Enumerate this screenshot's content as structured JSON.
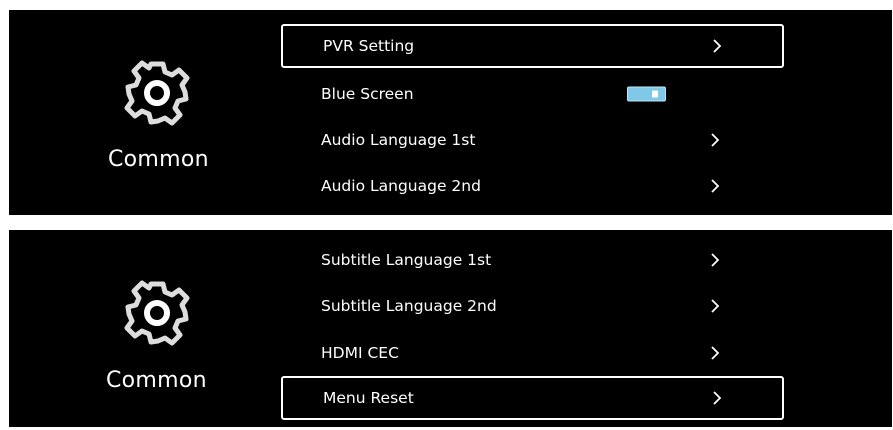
{
  "colors": {
    "background": "#000000",
    "text": "#ffffff",
    "focus_border": "#ffffff",
    "toggle_on": "#7fc8e8"
  },
  "panels": [
    {
      "category": {
        "icon": "gear-icon",
        "label": "Common"
      },
      "items": [
        {
          "label": "PVR Setting",
          "control": "chevron-right-icon",
          "focused": true
        },
        {
          "label": "Blue Screen",
          "control": "toggle",
          "state": "on",
          "focused": false
        },
        {
          "label": "Audio Language 1st",
          "control": "chevron-right-icon",
          "focused": false
        },
        {
          "label": "Audio Language 2nd",
          "control": "chevron-right-icon",
          "focused": false
        }
      ]
    },
    {
      "category": {
        "icon": "gear-icon",
        "label": "Common"
      },
      "items": [
        {
          "label": "Subtitle Language 1st",
          "control": "chevron-right-icon",
          "focused": false
        },
        {
          "label": "Subtitle Language 2nd",
          "control": "chevron-right-icon",
          "focused": false
        },
        {
          "label": "HDMI CEC",
          "control": "chevron-right-icon",
          "focused": false
        },
        {
          "label": "Menu Reset",
          "control": "chevron-right-icon",
          "focused": true
        }
      ]
    }
  ]
}
